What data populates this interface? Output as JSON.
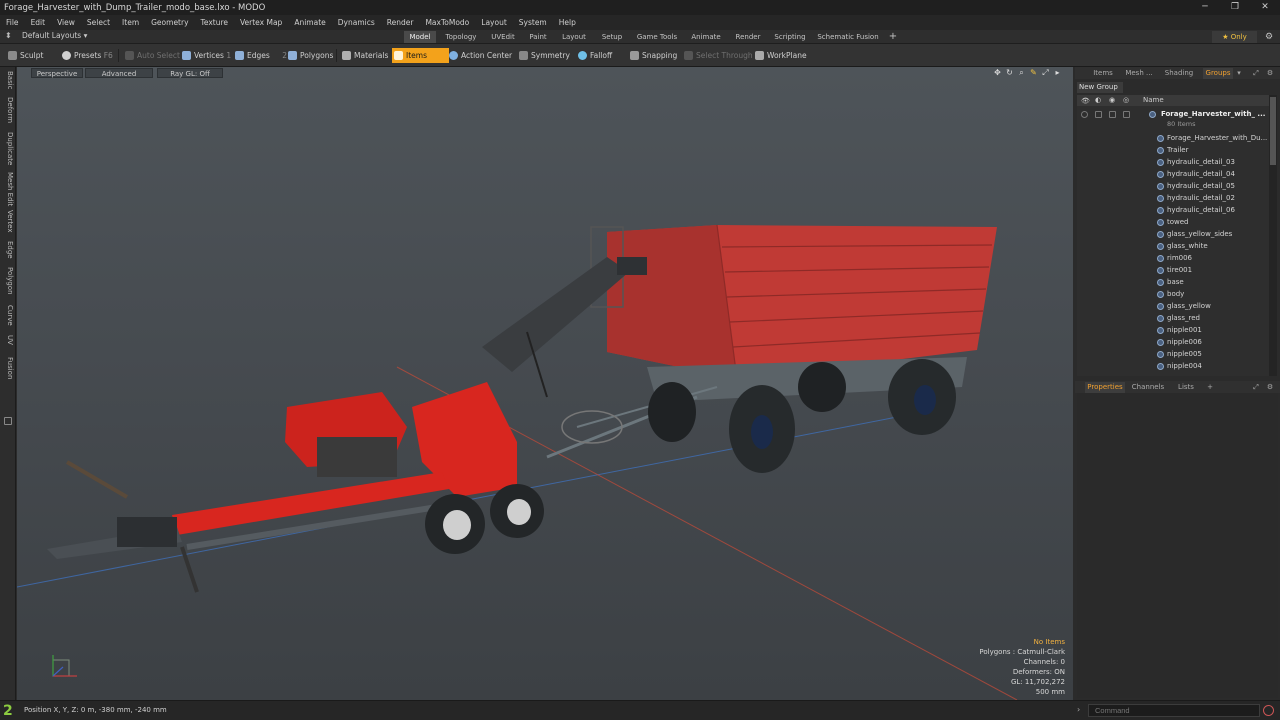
{
  "window": {
    "title": "Forage_Harvester_with_Dump_Trailer_modo_base.lxo - MODO",
    "minimize": "─",
    "maximize": "❐",
    "close": "✕"
  },
  "menu": [
    "File",
    "Edit",
    "View",
    "Select",
    "Item",
    "Geometry",
    "Texture",
    "Vertex Map",
    "Animate",
    "Dynamics",
    "Render",
    "MaxToModo",
    "Layout",
    "System",
    "Help"
  ],
  "layouts": {
    "name": "Default Layouts ▾",
    "tabs": [
      "Model",
      "Topology",
      "UVEdit",
      "Paint",
      "Layout",
      "Setup",
      "Game Tools",
      "Animate",
      "Render",
      "Scripting",
      "Schematic Fusion"
    ],
    "active": "Model",
    "add": "+",
    "only": "★ Only",
    "gear": "⚙"
  },
  "toolbar": {
    "sculpt": "Sculpt",
    "presets": "Presets",
    "presets_key": "F6",
    "auto_select": "Auto Select",
    "vertices": "Vertices",
    "vertices_key": "1",
    "edges": "Edges",
    "edges_key": "2",
    "polygons": "Polygons",
    "materials": "Materials",
    "items": "Items",
    "action_center": "Action Center",
    "symmetry": "Symmetry",
    "falloff": "Falloff",
    "snapping": "Snapping",
    "select_through": "Select Through",
    "workplane": "WorkPlane"
  },
  "left_tabs": [
    "Basic",
    "Deform",
    "Duplicate",
    "Mesh Edit",
    "Vertex",
    "Edge",
    "Polygon",
    "Curve",
    "UV",
    "Fusion"
  ],
  "viewport": {
    "view": "Perspective",
    "shading": "Advanced",
    "raygl": "Ray GL: Off",
    "stats": {
      "no_items": "No Items",
      "polygons": "Polygons : Catmull-Clark",
      "channels": "Channels: 0",
      "deformers": "Deformers: ON",
      "gl": "GL: 11,702,272",
      "scale": "500 mm"
    }
  },
  "right_panel": {
    "tabs": [
      "Items",
      "Mesh ...",
      "Shading",
      "Groups"
    ],
    "active_tab": "Groups",
    "new_group": "New Group",
    "col_name": "Name",
    "group_name": "Forage_Harvester_with_ ...",
    "group_count": "80 Items",
    "items": [
      "Forage_Harvester_with_Du...",
      "Trailer",
      "hydraulic_detail_03",
      "hydraulic_detail_04",
      "hydraulic_detail_05",
      "hydraulic_detail_02",
      "hydraulic_detail_06",
      "towed",
      "glass_yellow_sides",
      "glass_white",
      "rim006",
      "tire001",
      "base",
      "body",
      "glass_yellow",
      "glass_red",
      "nipple001",
      "nipple006",
      "nipple005",
      "nipple004"
    ],
    "prop_tabs": [
      "Properties",
      "Channels",
      "Lists"
    ],
    "prop_active": "Properties",
    "prop_add": "+"
  },
  "status": {
    "number": "2",
    "position": "Position X, Y, Z:   0 m, -380 mm, -240 mm",
    "command_placeholder": "Command"
  },
  "colors": {
    "accent": "#f3a21b",
    "trailer_red": "#c03a35",
    "harvester_red": "#d8261f",
    "viewport_bg": "#474c51"
  }
}
